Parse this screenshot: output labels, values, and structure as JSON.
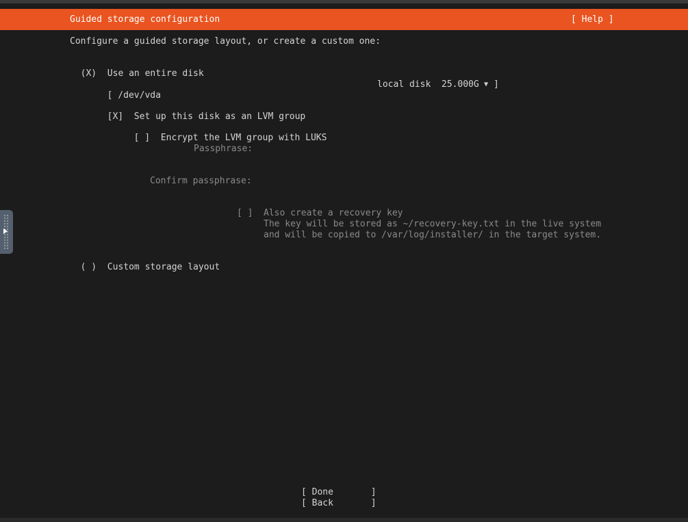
{
  "header": {
    "title": "Guided storage configuration",
    "help": "[ Help ]"
  },
  "intro": "Configure a guided storage layout, or create a custom one:",
  "entire_disk": {
    "radio": "(X)",
    "label": "Use an entire disk",
    "disk_path": "[ /dev/vda",
    "disk_info": "local disk  25.000G",
    "disk_close": "]",
    "lvm_checkbox": "[X]",
    "lvm_label": "Set up this disk as an LVM group",
    "encrypt_checkbox": "[ ]",
    "encrypt_label": "Encrypt the LVM group with LUKS",
    "passphrase_label": "Passphrase:",
    "passphrase_value": "",
    "confirm_label": "Confirm passphrase:",
    "confirm_value": "",
    "recovery_checkbox": "[ ]",
    "recovery_label": "Also create a recovery key",
    "recovery_note_1": "The key will be stored as ~/recovery-key.txt in the live system",
    "recovery_note_2": "and will be copied to /var/log/installer/ in the target system."
  },
  "custom": {
    "radio": "( )",
    "label": "Custom storage layout"
  },
  "buttons": {
    "done": "[ Done       ]",
    "back": "[ Back       ]"
  },
  "colors": {
    "accent": "#e95420",
    "background": "#1c1c1c",
    "text": "#d4d4d4",
    "dim_text": "#8a8a8a"
  }
}
